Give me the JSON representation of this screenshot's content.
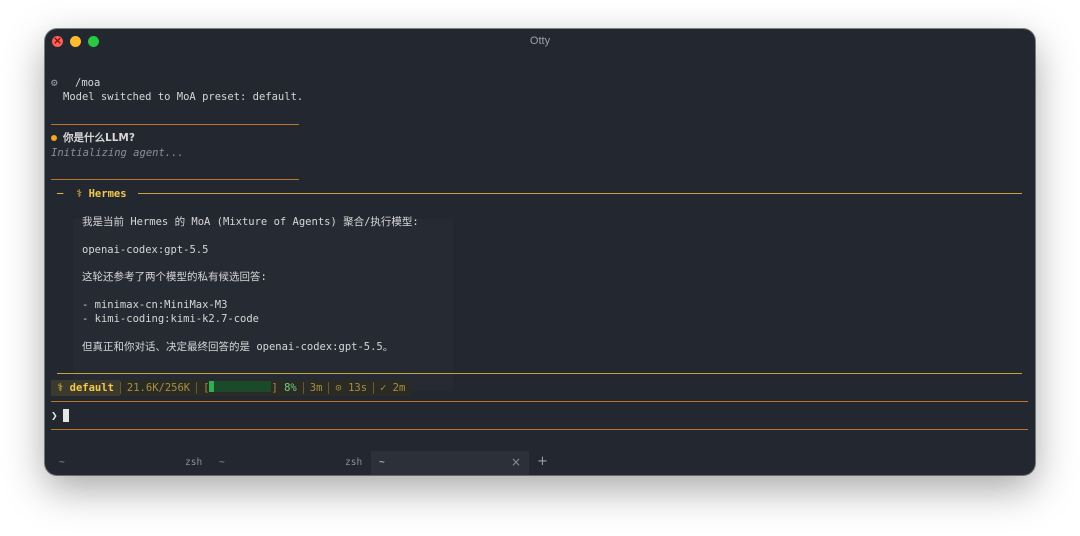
{
  "window": {
    "title": "Otty"
  },
  "history": {
    "command": "/moa",
    "command_output": "Model switched to MoA preset: default.",
    "user_prompt": "你是什么LLM?",
    "status_text": "Initializing agent..."
  },
  "response": {
    "header_label": "─  ⚕ Hermes",
    "lines": [
      "我是当前 Hermes 的 MoA (Mixture of Agents) 聚合/执行模型:",
      "openai-codex:gpt-5.5",
      "这轮还参考了两个模型的私有候选回答:",
      "- minimax-cn:MiniMax-M3",
      "- kimi-coding:kimi-k2.7-code",
      "但真正和你对话、决定最终回答的是 openai-codex:gpt-5.5。"
    ]
  },
  "statusbar": {
    "preset": "⚕ default",
    "tokens": "21.6K/256K",
    "bar_open": "[",
    "bar_close": "]",
    "usage_fraction": 0.08,
    "usage_pct": "8%",
    "elapsed": "3m",
    "timer": "⊙ 13s",
    "done": "✓ 2m"
  },
  "input": {
    "prompt_symbol": "❯"
  },
  "tabs": [
    {
      "left": "~",
      "right": "zsh"
    },
    {
      "left": "~",
      "right": "zsh"
    },
    {
      "left": "~",
      "right": ""
    }
  ],
  "tab_close": "×",
  "tab_add": "+",
  "colors": {
    "accent": "#f2c94c",
    "rule": "#b8762f",
    "bar": "#2fae52",
    "background": "#23272f"
  }
}
